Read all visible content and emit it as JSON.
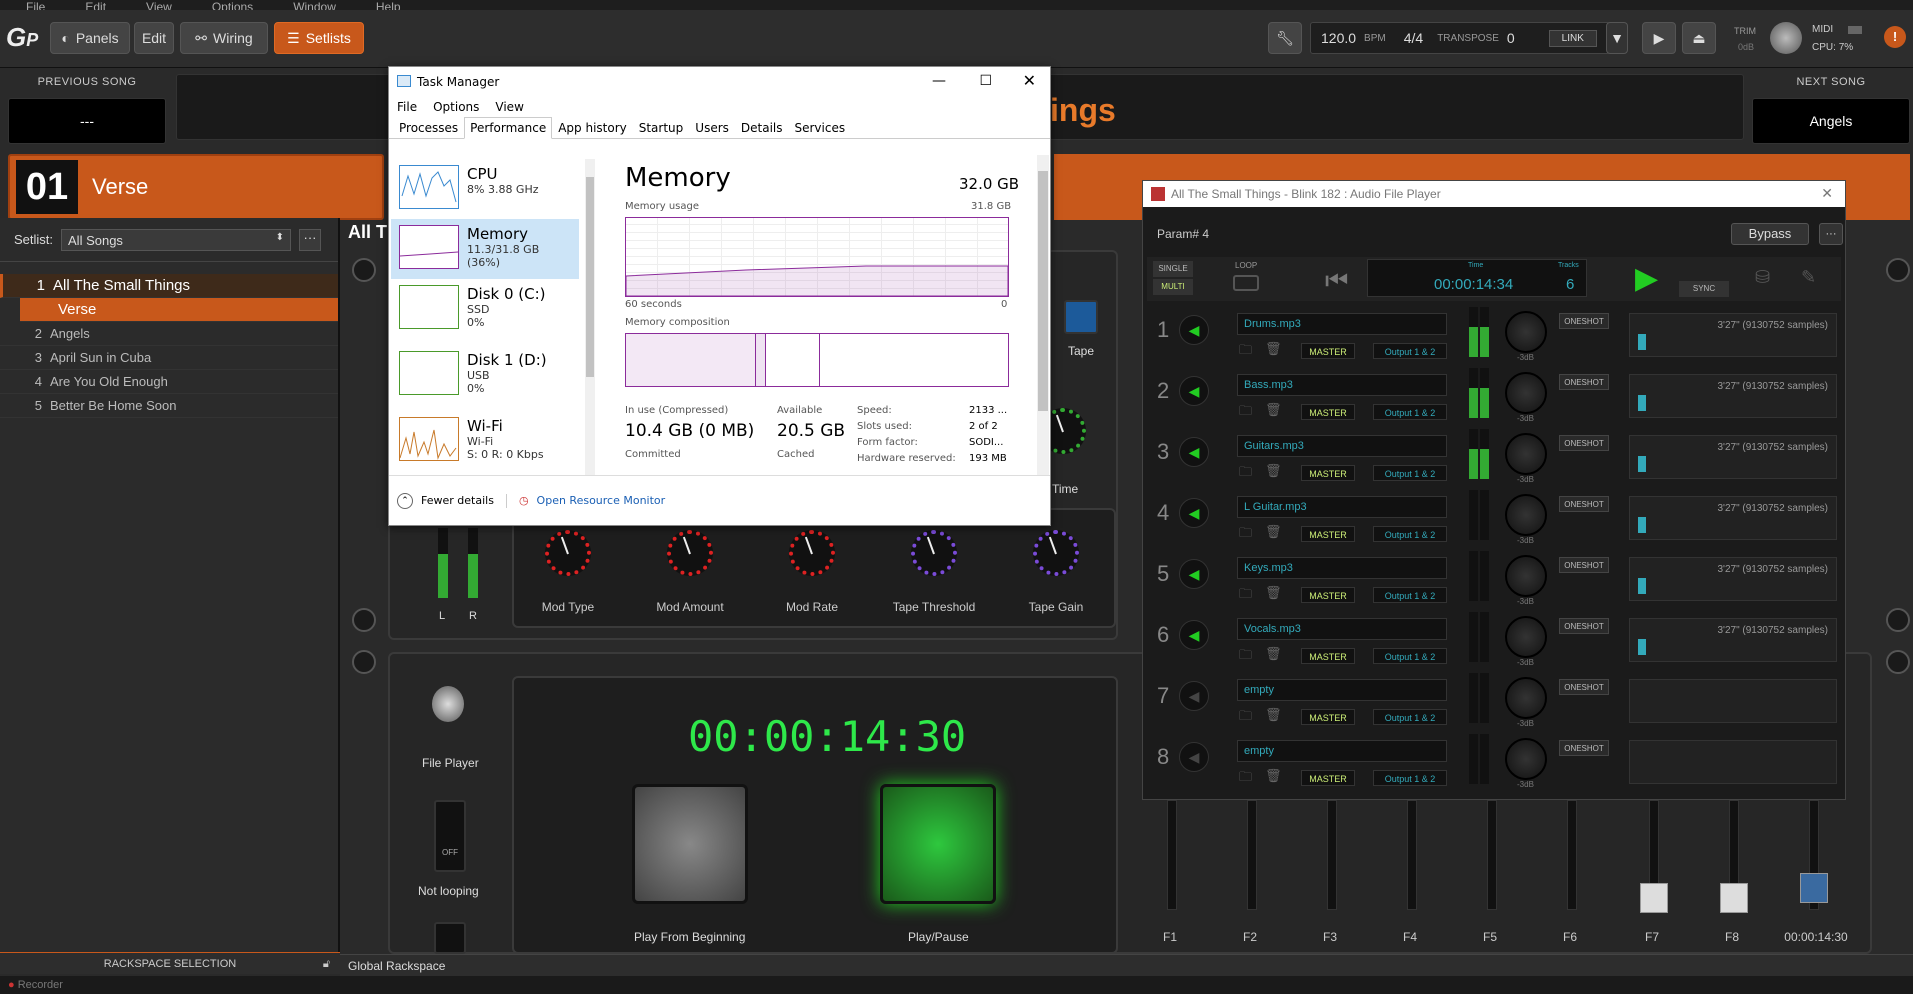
{
  "menubar": [
    "File",
    "Edit",
    "View",
    "Options",
    "Window",
    "Help"
  ],
  "toolbar": {
    "panels": "Panels",
    "edit": "Edit",
    "wiring": "Wiring",
    "setlists": "Setlists",
    "bpm": "120.0",
    "bpm_unit": "BPM",
    "sig": "4/4",
    "transpose_label": "TRANSPOSE",
    "transpose": "0",
    "link": "LINK",
    "trim_label": "TRIM",
    "trim_value": "0dB",
    "midi": "MIDI",
    "cpu": "CPU:",
    "cpu_val": "7%"
  },
  "songs": {
    "prev_label": "PREVIOUS SONG",
    "prev_value": "---",
    "next_label": "NEXT SONG",
    "next_value": "Angels",
    "current_title_frag": "ings"
  },
  "part": {
    "number": "01",
    "name": "Verse"
  },
  "setlist": {
    "label": "Setlist:",
    "value": "All Songs",
    "more": "···",
    "items": [
      {
        "n": "1",
        "name": "All The Small Things",
        "active": true
      },
      {
        "n": "",
        "name": "Verse",
        "part": true
      },
      {
        "n": "2",
        "name": "Angels"
      },
      {
        "n": "3",
        "name": "April Sun in Cuba"
      },
      {
        "n": "4",
        "name": "Are You Old Enough"
      },
      {
        "n": "5",
        "name": "Better Be Home Soon"
      }
    ]
  },
  "rackspace": {
    "header_frag": "All T",
    "selection_label": "RACKSPACE SELECTION",
    "global": "Global Rackspace",
    "recorder": "Recorder"
  },
  "knobs": [
    {
      "label": "Mod Type"
    },
    {
      "label": "Mod Amount"
    },
    {
      "label": "Mod Rate"
    },
    {
      "label": "Tape Threshold"
    },
    {
      "label": "Tape Gain"
    }
  ],
  "tape": {
    "label": "Tape",
    "time_label": "Time"
  },
  "meter": {
    "l": "L",
    "r": "R"
  },
  "player": {
    "file_player": "File Player",
    "not_looping": "Not looping",
    "off": "OFF",
    "timer": "00:00:14:30",
    "play_from_beginning": "Play From Beginning",
    "play_pause": "Play/Pause"
  },
  "task_manager": {
    "title": "Task Manager",
    "menu": [
      "File",
      "Options",
      "View"
    ],
    "tabs": [
      "Processes",
      "Performance",
      "App history",
      "Startup",
      "Users",
      "Details",
      "Services"
    ],
    "active_tab": "Performance",
    "side": [
      {
        "name": "CPU",
        "l2": "8% 3.88 GHz",
        "l3": ""
      },
      {
        "name": "Memory",
        "l2": "11.3/31.8 GB (36%)",
        "l3": ""
      },
      {
        "name": "Disk 0 (C:)",
        "l2": "SSD",
        "l3": "0%"
      },
      {
        "name": "Disk 1 (D:)",
        "l2": "USB",
        "l3": "0%"
      },
      {
        "name": "Wi-Fi",
        "l2": "Wi-Fi",
        "l3": "S: 0 R: 0 Kbps"
      }
    ],
    "heading": "Memory",
    "total": "32.0 GB",
    "usage_label": "Memory usage",
    "usage_max": "31.8 GB",
    "seconds": "60 seconds",
    "zero": "0",
    "composition": "Memory composition",
    "stats": {
      "inuse_label": "In use (Compressed)",
      "inuse": "10.4 GB (0 MB)",
      "avail_label": "Available",
      "avail": "20.5 GB",
      "committed_label": "Committed",
      "cached_label": "Cached",
      "speed_label": "Speed:",
      "speed": "2133 ...",
      "slots_label": "Slots used:",
      "slots": "2 of 2",
      "form_label": "Form factor:",
      "form": "SODI...",
      "hw_label": "Hardware reserved:",
      "hw": "193 MB"
    },
    "fewer": "Fewer details",
    "orm": "Open Resource Monitor"
  },
  "afp": {
    "title": "All The Small Things - Blink 182 : Audio File Player",
    "param": "Param# 4",
    "bypass": "Bypass",
    "single": "SINGLE",
    "multi": "MULTI",
    "loop": "LOOP",
    "time_label": "Time",
    "time": "00:00:14:34",
    "tracks_label": "Tracks",
    "tracks": "6",
    "sync": "SYNC",
    "rows": [
      {
        "n": "1",
        "file": "Drums.mp3",
        "dur": "3'27\" (9130752 samples)",
        "on": true
      },
      {
        "n": "2",
        "file": "Bass.mp3",
        "dur": "3'27\" (9130752 samples)",
        "on": true
      },
      {
        "n": "3",
        "file": "Guitars.mp3",
        "dur": "3'27\" (9130752 samples)",
        "on": true
      },
      {
        "n": "4",
        "file": "L Guitar.mp3",
        "dur": "3'27\" (9130752 samples)",
        "on": true
      },
      {
        "n": "5",
        "file": "Keys.mp3",
        "dur": "3'27\" (9130752 samples)",
        "on": true
      },
      {
        "n": "6",
        "file": "Vocals.mp3",
        "dur": "3'27\" (9130752 samples)",
        "on": true
      },
      {
        "n": "7",
        "file": "empty",
        "dur": "",
        "on": false
      },
      {
        "n": "8",
        "file": "empty",
        "dur": "",
        "on": false
      }
    ],
    "master": "MASTER",
    "output": "Output 1 & 2",
    "oneshot": "ONESHOT",
    "db": "-3dB"
  },
  "faders": [
    "F1",
    "F2",
    "F3",
    "F4",
    "F5",
    "F6",
    "F7",
    "F8",
    "00:00:14:30"
  ]
}
